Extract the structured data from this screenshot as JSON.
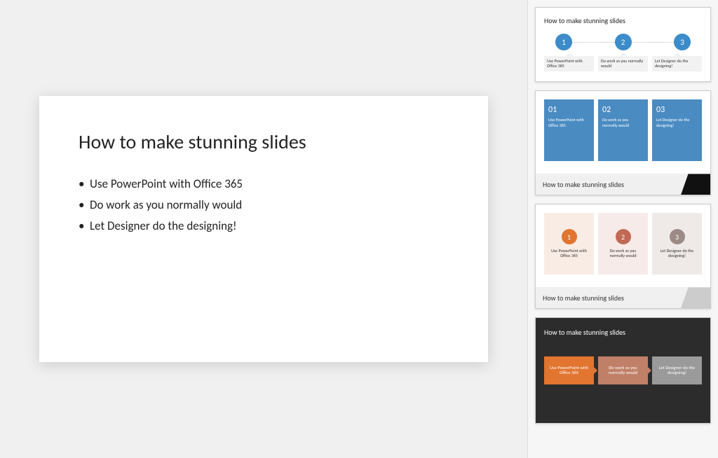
{
  "main_slide": {
    "title": "How to make stunning slides",
    "bullets": [
      "Use PowerPoint with Office 365",
      "Do work as you normally would",
      "Let Designer do the designing!"
    ]
  },
  "designer": {
    "options": [
      {
        "title": "How to make stunning slides",
        "steps": [
          "1",
          "2",
          "3"
        ],
        "captions": [
          "Use PowerPoint with Office 365",
          "Do work as you normally would",
          "Let Designer do the designing!"
        ]
      },
      {
        "tiles": [
          {
            "num": "01",
            "txt": "Use PowerPoint with Office 365"
          },
          {
            "num": "02",
            "txt": "Do work as you normally would"
          },
          {
            "num": "03",
            "txt": "Let Designer do the designing!"
          }
        ],
        "footer": "How to make stunning slides"
      },
      {
        "tiles": [
          {
            "num": "1",
            "txt": "Use PowerPoint with Office 365"
          },
          {
            "num": "2",
            "txt": "Do work as you normally would"
          },
          {
            "num": "3",
            "txt": "Let Designer do the designing!"
          }
        ],
        "footer": "How to make stunning slides"
      },
      {
        "title": "How to make stunning slides",
        "tiles": [
          "Use PowerPoint with Office 365",
          "Do work as you normally would",
          "Let Designer do the designing!"
        ]
      }
    ]
  }
}
